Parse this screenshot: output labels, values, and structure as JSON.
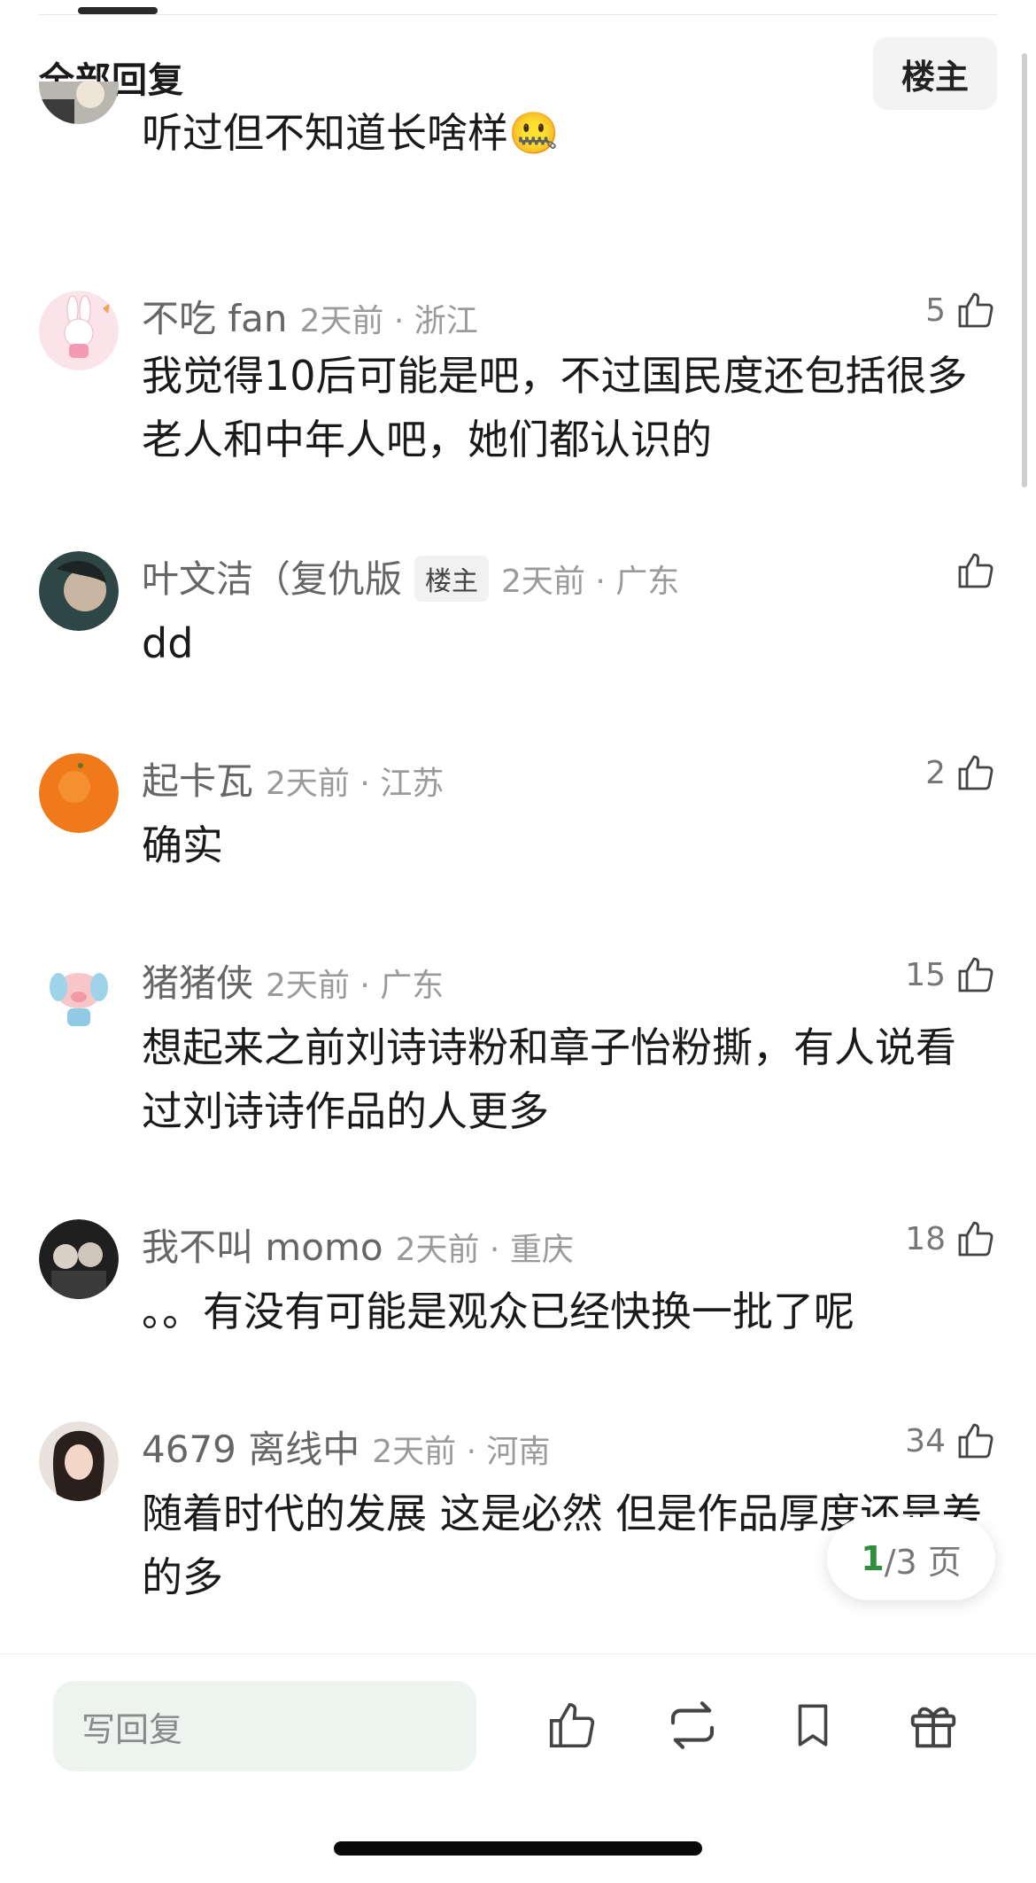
{
  "header": {
    "title": "全部回复",
    "op_button": "楼主"
  },
  "comments": [
    {
      "username": "",
      "meta": "",
      "likes": "",
      "text": "听过但不知道长啥样🤐"
    },
    {
      "username": "不吃 fan",
      "meta": "2天前 · 浙江",
      "likes": "5",
      "text": "我觉得10后可能是吧，不过国民度还包括很多老人和中年人吧，她们都认识的"
    },
    {
      "username": "叶文洁（复仇版",
      "tag": "楼主",
      "meta": "2天前 · 广东",
      "likes": "",
      "text": "dd"
    },
    {
      "username": "起卡瓦",
      "meta": "2天前 · 江苏",
      "likes": "2",
      "text": "确实"
    },
    {
      "username": "猪猪侠",
      "meta": "2天前 · 广东",
      "likes": "15",
      "text": "想起来之前刘诗诗粉和章子怡粉撕，有人说看过刘诗诗作品的人更多"
    },
    {
      "username": "我不叫 momo",
      "meta": "2天前 · 重庆",
      "likes": "18",
      "text": "。。有没有可能是观众已经快换一批了呢"
    },
    {
      "username": "4679 离线中",
      "meta": "2天前 · 河南",
      "likes": "34",
      "text": "随着时代的发展 这是必然 但是作品厚度还是差的多"
    }
  ],
  "pager": {
    "current": "1",
    "rest": "/3 页"
  },
  "bottom_bar": {
    "reply_placeholder": "写回复",
    "icons": [
      "thumb-up-icon",
      "repost-icon",
      "bookmark-icon",
      "gift-icon"
    ]
  },
  "colors": {
    "accent": "#2f8f3a",
    "input_bg": "#edf3ee"
  }
}
